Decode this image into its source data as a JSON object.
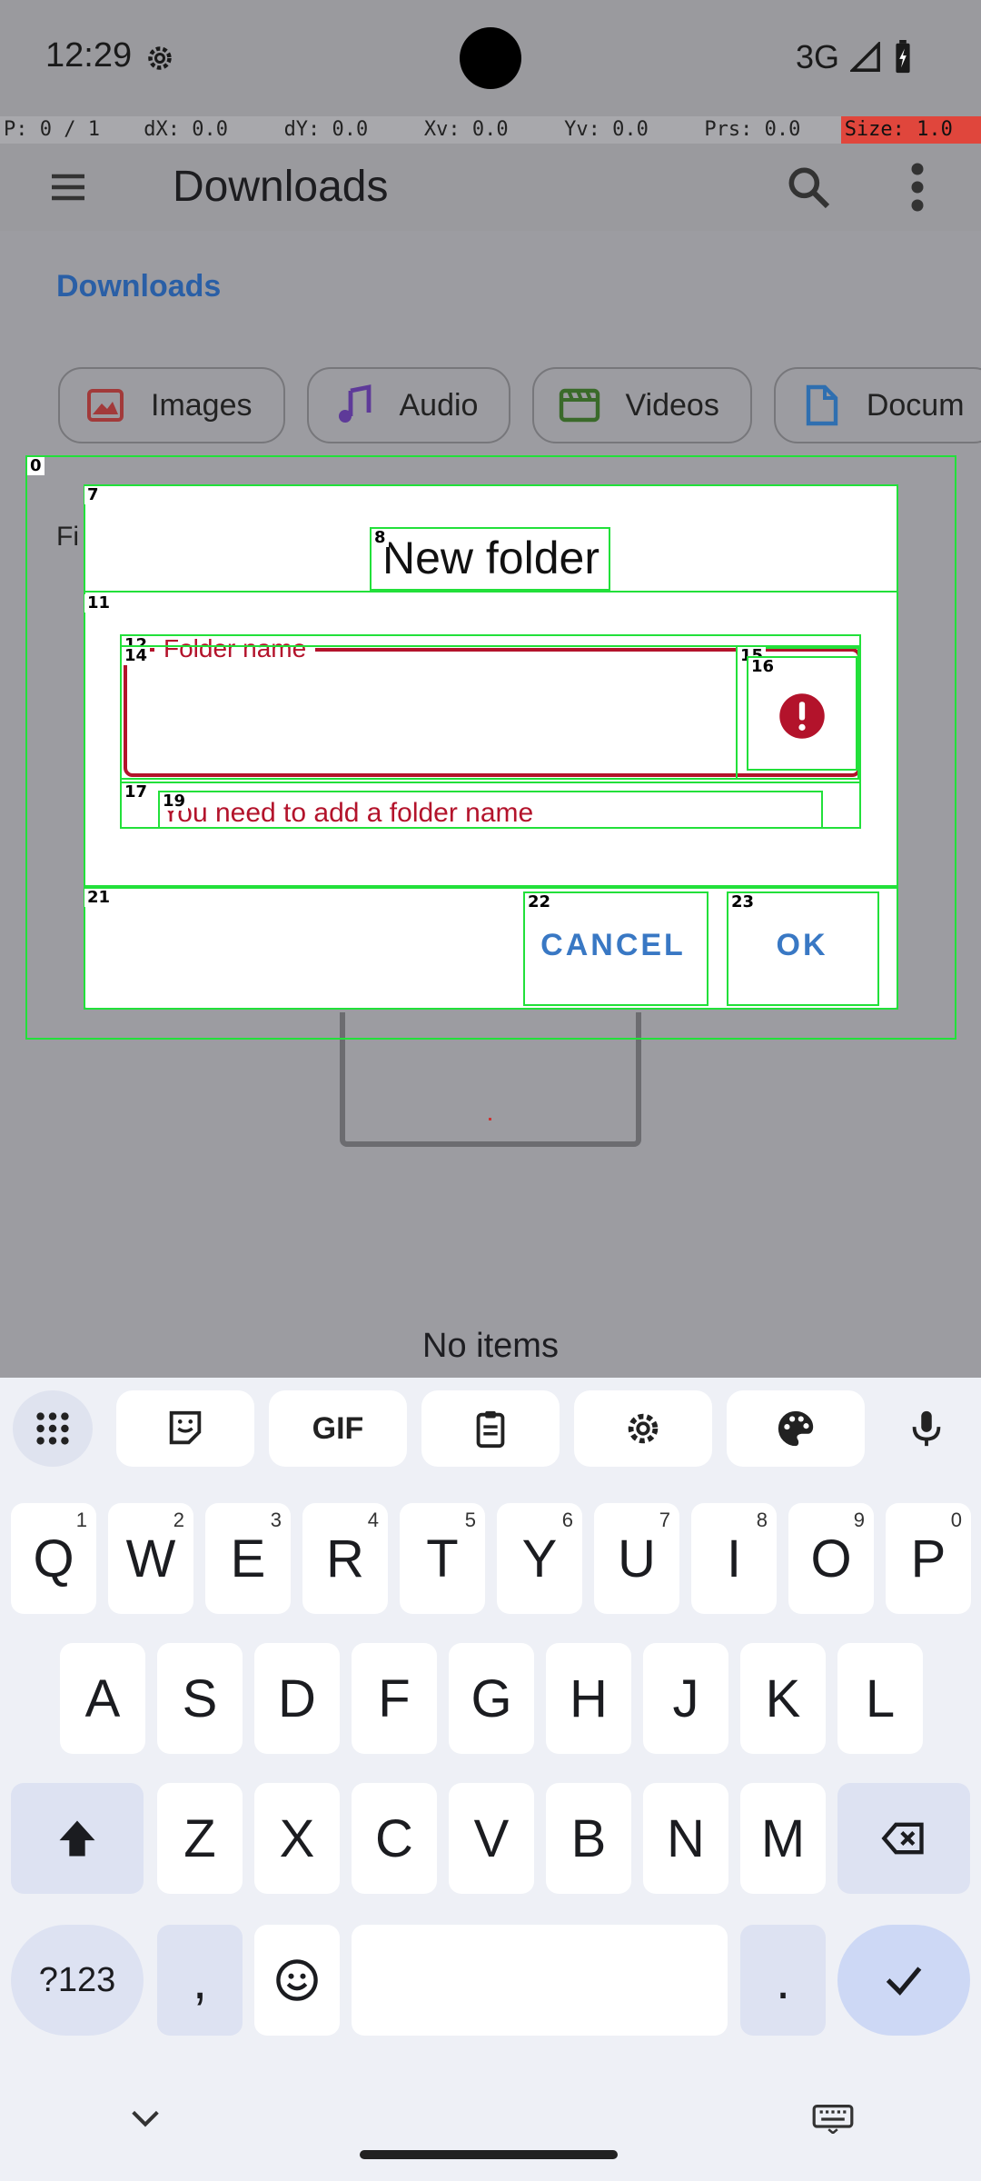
{
  "status_bar": {
    "time": "12:29",
    "network": "3G"
  },
  "pointer_bar": {
    "items": [
      "P: 0 / 1",
      "dX: 0.0",
      "dY: 0.0",
      "Xv: 0.0",
      "Yv: 0.0",
      "Prs: 0.0",
      "Size: 1.0"
    ]
  },
  "app_bar": {
    "title": "Downloads"
  },
  "breadcrumb": "Downloads",
  "chips": [
    {
      "label": "Images",
      "icon": "image-icon",
      "color": "#b03a3a"
    },
    {
      "label": "Audio",
      "icon": "music-note-icon",
      "color": "#6a3aa6"
    },
    {
      "label": "Videos",
      "icon": "video-icon",
      "color": "#3a7a3a"
    },
    {
      "label": "Docum",
      "icon": "document-icon",
      "color": "#2f6fb0"
    }
  ],
  "filter_prefix": "Fi",
  "empty_text": "No items",
  "dialog": {
    "title": "New folder",
    "field_label": "Folder name",
    "field_value": "",
    "helper_text": "You need to add a folder name",
    "cancel_label": "CANCEL",
    "ok_label": "OK"
  },
  "debug_boxes": [
    "0",
    "7",
    "8",
    "11",
    "12",
    "14",
    "15",
    "16",
    "17",
    "19",
    "21",
    "22",
    "23"
  ],
  "keyboard": {
    "row1": [
      {
        "k": "Q",
        "h": "1"
      },
      {
        "k": "W",
        "h": "2"
      },
      {
        "k": "E",
        "h": "3"
      },
      {
        "k": "R",
        "h": "4"
      },
      {
        "k": "T",
        "h": "5"
      },
      {
        "k": "Y",
        "h": "6"
      },
      {
        "k": "U",
        "h": "7"
      },
      {
        "k": "I",
        "h": "8"
      },
      {
        "k": "O",
        "h": "9"
      },
      {
        "k": "P",
        "h": "0"
      }
    ],
    "row2": [
      "A",
      "S",
      "D",
      "F",
      "G",
      "H",
      "J",
      "K",
      "L"
    ],
    "row3": [
      "Z",
      "X",
      "C",
      "V",
      "B",
      "N",
      "M"
    ],
    "symbols_label": "?123",
    "comma": ",",
    "period": ".",
    "gif_label": "GIF"
  },
  "colors": {
    "accent": "#3978c4",
    "error": "#b3132b",
    "debug": "#22e03a",
    "scrim": "#9c9ca1"
  }
}
